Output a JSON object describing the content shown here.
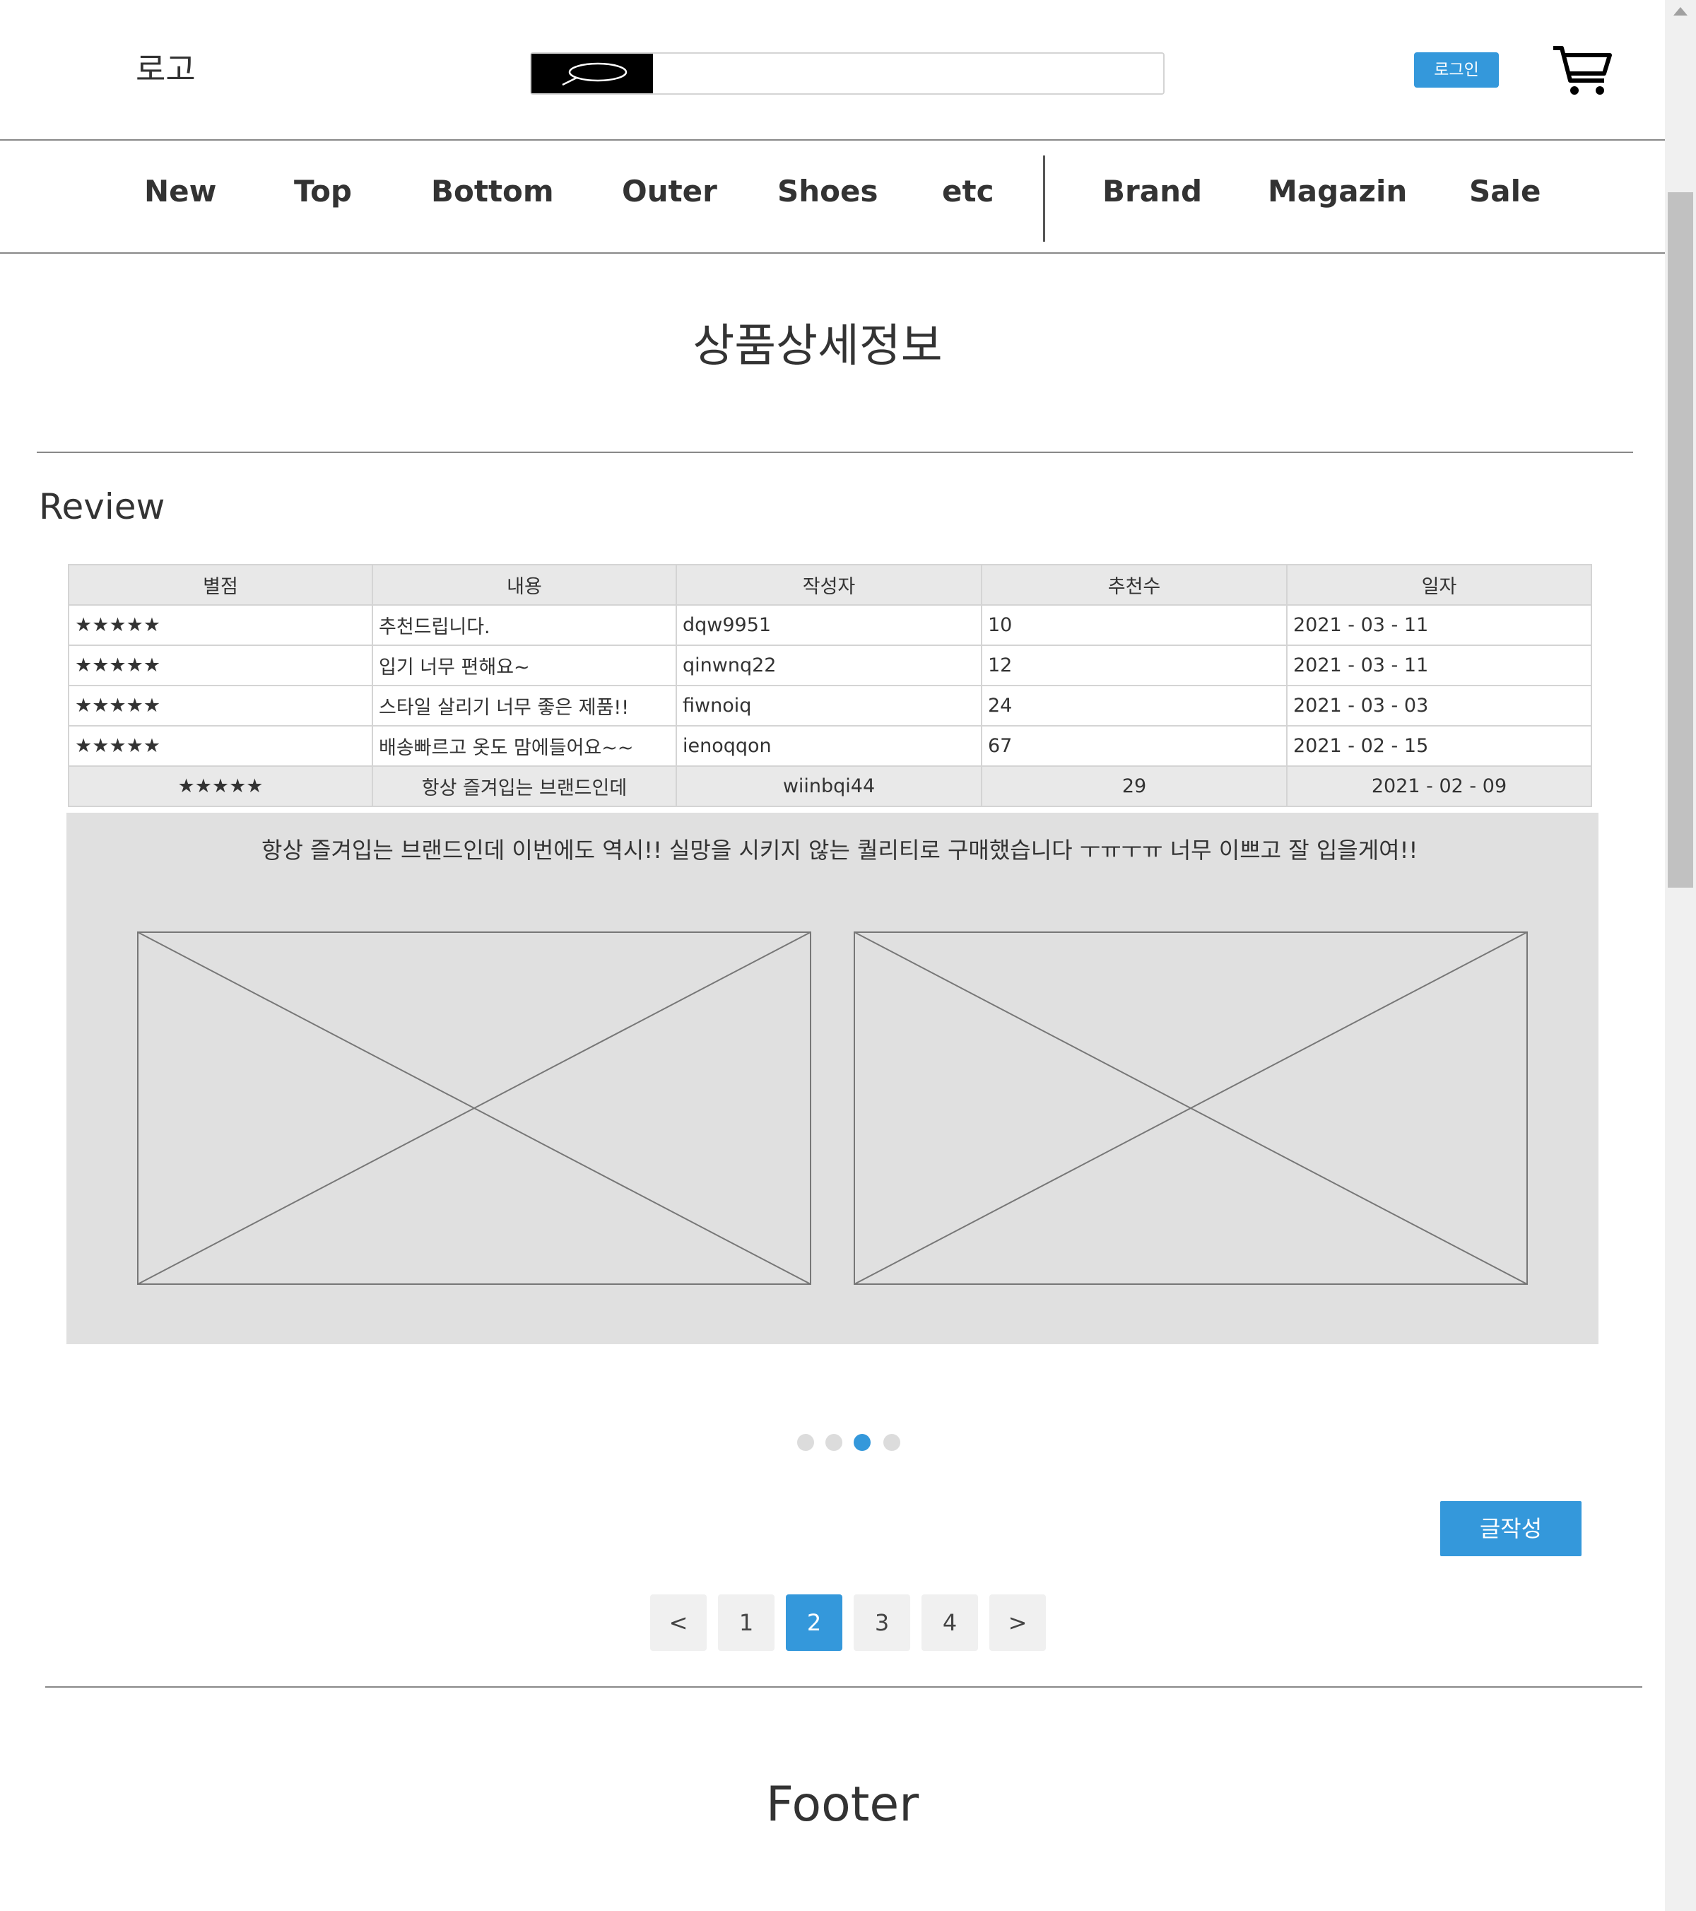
{
  "header": {
    "logo": "로고",
    "search_placeholder": "",
    "login_label": "로그인",
    "cart_icon": "cart-icon",
    "search_icon": "search-icon"
  },
  "nav": {
    "items": [
      "New",
      "Top",
      "Bottom",
      "Outer",
      "Shoes",
      "etc"
    ],
    "secondary": [
      "Brand",
      "Magazin",
      "Sale"
    ]
  },
  "page_title": "상품상세정보",
  "review": {
    "heading": "Review",
    "columns": [
      "별점",
      "내용",
      "작성자",
      "추천수",
      "일자"
    ],
    "rows": [
      {
        "stars": "★★★★★",
        "content": "추천드립니다.",
        "author": "dqw9951",
        "likes": "10",
        "date": "2021 - 03 - 11"
      },
      {
        "stars": "★★★★★",
        "content": "입기 너무 편해요~",
        "author": "qinwnq22",
        "likes": "12",
        "date": "2021 - 03 - 11"
      },
      {
        "stars": "★★★★★",
        "content": "스타일 살리기 너무 좋은 제품!!",
        "author": "fiwnoiq",
        "likes": "24",
        "date": "2021 - 03 - 03"
      },
      {
        "stars": "★★★★★",
        "content": "배송빠르고 옷도 맘에들어요~~",
        "author": "ienoqqon",
        "likes": "67",
        "date": "2021 - 02 - 15"
      },
      {
        "stars": "★★★★★",
        "content": "항상 즐겨입는 브랜드인데",
        "author": "wiinbqi44",
        "likes": "29",
        "date": "2021 - 02 - 09"
      }
    ],
    "expanded_text": "항상 즐겨입는 브랜드인데 이번에도 역시!! 실망을 시키지 않는 퀄리티로 구매했습니다 ㅜㅠㅜㅠ 너무 이쁘고 잘 입을게여!!"
  },
  "carousel": {
    "count": 4,
    "active_index": 2
  },
  "write_button": "글작성",
  "pagination": {
    "prev": "<",
    "pages": [
      "1",
      "2",
      "3",
      "4"
    ],
    "active": "2",
    "next": ">"
  },
  "footer": "Footer",
  "colors": {
    "accent": "#3498db",
    "panel": "#e0e0e0",
    "header_cell": "#e8e8e8"
  }
}
